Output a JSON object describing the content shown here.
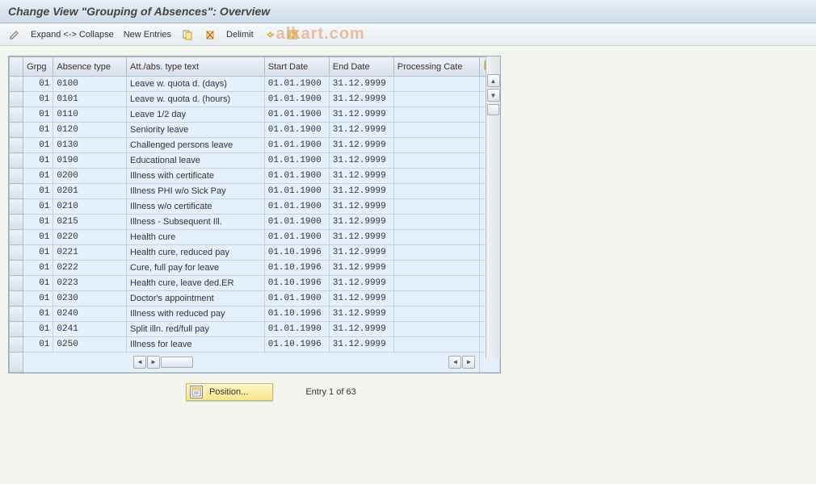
{
  "title": "Change View \"Grouping of Absences\": Overview",
  "toolbar": {
    "expand_collapse": "Expand <-> Collapse",
    "new_entries": "New Entries",
    "delimit": "Delimit"
  },
  "watermark": "alkart.com",
  "columns": {
    "grpg": "Grpg",
    "abstype": "Absence type",
    "text": "Att./abs. type text",
    "start": "Start Date",
    "end": "End Date",
    "proc": "Processing Cate"
  },
  "rows": [
    {
      "grpg": "01",
      "type": "0100",
      "text": "Leave w. quota d. (days)",
      "start": "01.01.1900",
      "end": "31.12.9999",
      "proc": ""
    },
    {
      "grpg": "01",
      "type": "0101",
      "text": "Leave w. quota d. (hours)",
      "start": "01.01.1900",
      "end": "31.12.9999",
      "proc": ""
    },
    {
      "grpg": "01",
      "type": "0110",
      "text": "Leave 1/2 day",
      "start": "01.01.1900",
      "end": "31.12.9999",
      "proc": ""
    },
    {
      "grpg": "01",
      "type": "0120",
      "text": "Seniority leave",
      "start": "01.01.1900",
      "end": "31.12.9999",
      "proc": ""
    },
    {
      "grpg": "01",
      "type": "0130",
      "text": "Challenged persons leave",
      "start": "01.01.1900",
      "end": "31.12.9999",
      "proc": ""
    },
    {
      "grpg": "01",
      "type": "0190",
      "text": "Educational leave",
      "start": "01.01.1900",
      "end": "31.12.9999",
      "proc": ""
    },
    {
      "grpg": "01",
      "type": "0200",
      "text": "Illness with certificate",
      "start": "01.01.1900",
      "end": "31.12.9999",
      "proc": ""
    },
    {
      "grpg": "01",
      "type": "0201",
      "text": "Illness PHI w/o Sick Pay",
      "start": "01.01.1900",
      "end": "31.12.9999",
      "proc": ""
    },
    {
      "grpg": "01",
      "type": "0210",
      "text": "Illness w/o certificate",
      "start": "01.01.1900",
      "end": "31.12.9999",
      "proc": ""
    },
    {
      "grpg": "01",
      "type": "0215",
      "text": "Illness - Subsequent Ill.",
      "start": "01.01.1900",
      "end": "31.12.9999",
      "proc": ""
    },
    {
      "grpg": "01",
      "type": "0220",
      "text": "Health cure",
      "start": "01.01.1900",
      "end": "31.12.9999",
      "proc": ""
    },
    {
      "grpg": "01",
      "type": "0221",
      "text": "Health cure, reduced pay",
      "start": "01.10.1996",
      "end": "31.12.9999",
      "proc": ""
    },
    {
      "grpg": "01",
      "type": "0222",
      "text": "Cure, full pay for leave",
      "start": "01.10.1996",
      "end": "31.12.9999",
      "proc": ""
    },
    {
      "grpg": "01",
      "type": "0223",
      "text": "Health cure, leave ded.ER",
      "start": "01.10.1996",
      "end": "31.12.9999",
      "proc": ""
    },
    {
      "grpg": "01",
      "type": "0230",
      "text": "Doctor's appointment",
      "start": "01.01.1900",
      "end": "31.12.9999",
      "proc": ""
    },
    {
      "grpg": "01",
      "type": "0240",
      "text": "Illness with reduced pay",
      "start": "01.10.1996",
      "end": "31.12.9999",
      "proc": ""
    },
    {
      "grpg": "01",
      "type": "0241",
      "text": "Split illn. red/full pay",
      "start": "01.01.1990",
      "end": "31.12.9999",
      "proc": ""
    },
    {
      "grpg": "01",
      "type": "0250",
      "text": "Illness for leave",
      "start": "01.10.1996",
      "end": "31.12.9999",
      "proc": ""
    }
  ],
  "footer": {
    "position": "Position...",
    "entry": "Entry 1 of 63"
  }
}
